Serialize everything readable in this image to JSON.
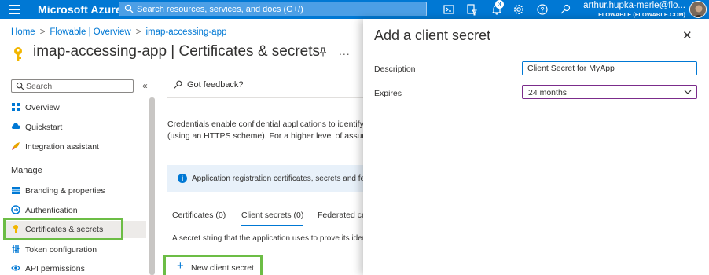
{
  "topbar": {
    "brand": "Microsoft Azure",
    "search_placeholder": "Search resources, services, and docs (G+/)",
    "notification_count": "3",
    "user_name": "arthur.hupka-merle@flo...",
    "user_org": "FLOWABLE (FLOWABLE.COM)",
    "color": "#0078d4"
  },
  "breadcrumb": {
    "items": [
      "Home",
      "Flowable | Overview",
      "imap-accessing-app"
    ]
  },
  "page": {
    "title": "imap-accessing-app | Certificates & secrets",
    "more": "..."
  },
  "sidebar": {
    "search_placeholder": "Search",
    "collapse": "«",
    "items": [
      {
        "label": "Overview",
        "icon": "grid-icon"
      },
      {
        "label": "Quickstart",
        "icon": "cloud-icon"
      },
      {
        "label": "Integration assistant",
        "icon": "rocket-icon"
      }
    ],
    "manage_header": "Manage",
    "manage_items": [
      {
        "label": "Branding & properties",
        "icon": "branding-icon"
      },
      {
        "label": "Authentication",
        "icon": "auth-icon"
      },
      {
        "label": "Certificates & secrets",
        "icon": "key-icon",
        "active": true
      },
      {
        "label": "Token configuration",
        "icon": "token-icon"
      },
      {
        "label": "API permissions",
        "icon": "api-icon"
      }
    ]
  },
  "main": {
    "feedback": "Got feedback?",
    "description_line1": "Credentials enable confidential applications to identify the",
    "description_line2": "(using an HTTPS scheme). For a higher level of assurance,",
    "info_text": "Application registration certificates, secrets and federa",
    "tabs": [
      "Certificates (0)",
      "Client secrets (0)",
      "Federated cr"
    ],
    "active_tab": "Client secrets (0)",
    "secret_note": "A secret string that the application uses to prove its ider",
    "new_secret_label": "New client secret"
  },
  "blade": {
    "title": "Add a client secret",
    "close": "✕",
    "description_label": "Description",
    "description_value": "Client Secret for MyApp",
    "expires_label": "Expires",
    "expires_value": "24 months"
  },
  "highlight_color": "#6cbd45"
}
